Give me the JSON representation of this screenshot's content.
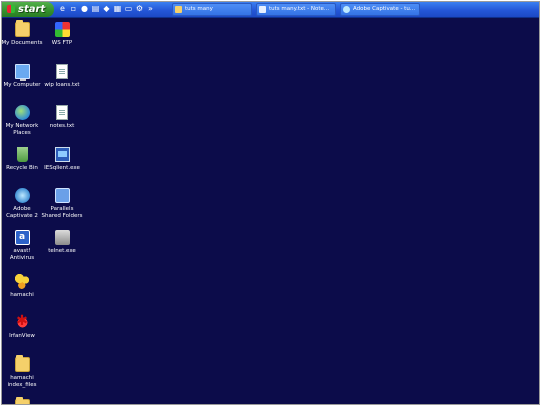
{
  "taskbar": {
    "start_label": "start",
    "quick_launch": [
      "ie-icon",
      "show-desktop-icon",
      "media-icon",
      "explorer-icon",
      "app-icon",
      "grid-icon",
      "window-icon",
      "tools-icon"
    ],
    "tasks": [
      {
        "label": "tuts many",
        "icon": "folder-icon",
        "color": "#f5d06a"
      },
      {
        "label": "tuts many.txt - Note...",
        "icon": "notepad-icon",
        "color": "#e8f0ff"
      },
      {
        "label": "Adobe Captivate - tu...",
        "icon": "captivate-icon",
        "color": "#bde8ff"
      }
    ]
  },
  "desktop": {
    "icons": [
      {
        "label": "My Documents",
        "icon": "my-documents-icon"
      },
      {
        "label": "WS FTP",
        "icon": "ws-ftp-icon"
      },
      {
        "label": "My Computer",
        "icon": "my-computer-icon"
      },
      {
        "label": "wip loans.txt",
        "icon": "text-file-icon"
      },
      {
        "label": "My Network\nPlaces",
        "icon": "network-places-icon"
      },
      {
        "label": "notes.txt",
        "icon": "text-file-icon"
      },
      {
        "label": "Recycle Bin",
        "icon": "recycle-bin-icon"
      },
      {
        "label": "IESqlient.exe",
        "icon": "exe-icon"
      },
      {
        "label": "Adobe\nCaptivate 2",
        "icon": "adobe-captivate-icon"
      },
      {
        "label": "Parallels\nShared Folders",
        "icon": "shared-folders-icon"
      },
      {
        "label": "avast!\nAntivirus",
        "icon": "avast-icon"
      },
      {
        "label": "telnet.exe",
        "icon": "telnet-icon"
      },
      {
        "label": "hamachi",
        "icon": "hamachi-icon"
      },
      {
        "label": "IrfanView",
        "icon": "irfanview-icon"
      },
      {
        "label": "hamachi\nindex_files",
        "icon": "folder-icon"
      },
      {
        "label": "",
        "icon": "folder-icon"
      }
    ]
  },
  "colors": {
    "desktop_bg": "#0c0c4a",
    "taskbar": "#2457d8",
    "start_button": "#33902c"
  }
}
